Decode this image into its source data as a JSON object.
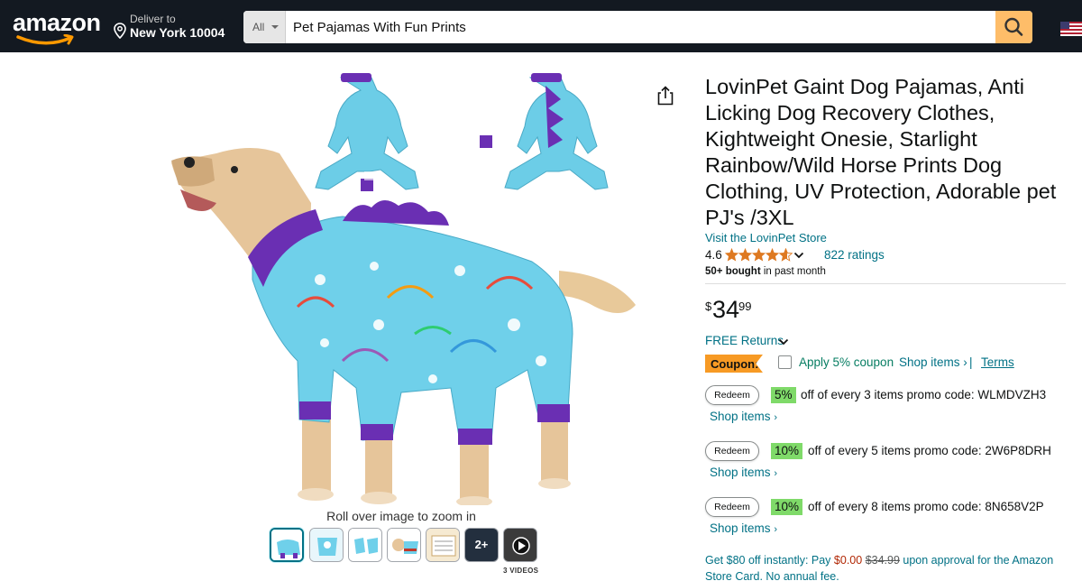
{
  "header": {
    "logo_text": "amazon",
    "deliver_line1": "Deliver to",
    "deliver_line2": "New York 10004",
    "search_category": "All",
    "search_value": "Pet Pajamas With Fun Prints",
    "search_icon": "search-icon",
    "accent_color": "#febd69",
    "bg_color": "#131921"
  },
  "gallery": {
    "zoom_hint": "Roll over image to zoom in",
    "more_count": "2+",
    "videos_label": "3 VIDEOS",
    "thumbnails": 7
  },
  "product": {
    "title": "LovinPet Gaint Dog Pajamas, Anti Licking Dog Recovery Clothes, Kightweight Onesie, Starlight Rainbow/Wild Horse Prints Dog Clothing, UV Protection, Adorable pet PJ's /3XL",
    "store_link": "Visit the LovinPet Store",
    "rating": "4.6",
    "stars": 4.6,
    "ratings_count": "822 ratings",
    "bought_bold": "50+ bought",
    "bought_rest": "in past month",
    "price_symbol": "$",
    "price_whole": "34",
    "price_fraction": "99",
    "free_returns": "FREE Returns"
  },
  "coupon": {
    "badge": "Coupon:",
    "apply_text": "Apply 5% coupon",
    "shop_items": "Shop items ›",
    "separator": "|",
    "terms": "Terms",
    "badge_color": "#f79a24"
  },
  "promos": [
    {
      "redeem": "Redeem",
      "percent": "5%",
      "text": "off of every 3 items promo code: WLMDVZH3",
      "shop": "Shop items"
    },
    {
      "redeem": "Redeem",
      "percent": "10%",
      "text": "off of every 5 items promo code: 2W6P8DRH",
      "shop": "Shop items"
    },
    {
      "redeem": "Redeem",
      "percent": "10%",
      "text": "off of every 8 items promo code: 8N658V2P",
      "shop": "Shop items"
    }
  ],
  "card_offer": {
    "prefix": "Get $80 off instantly: Pay",
    "pay": "$0.00",
    "original": "$34.99",
    "suffix": "upon approval for the Amazon Store Card. No annual fee."
  }
}
